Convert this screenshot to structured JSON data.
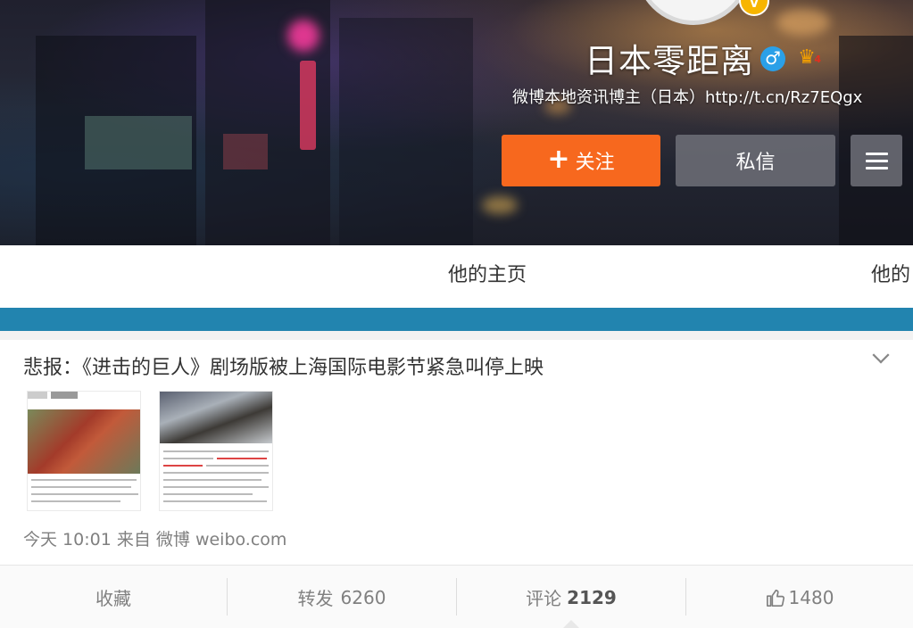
{
  "profile": {
    "name": "日本零距离",
    "description": "微博本地资讯博主（日本）http://t.cn/Rz7EQgx",
    "gender_symbol": "♂",
    "verified_badge": "V",
    "vip_symbol": "♛",
    "vip_level": "4"
  },
  "buttons": {
    "follow_icon": "+",
    "follow_label": "关注",
    "message_label": "私信",
    "menu_icon": "menu-icon"
  },
  "tabs": [
    {
      "label": "他的主页"
    },
    {
      "label": "他的"
    }
  ],
  "post": {
    "title": "悲报：《进击的巨人》剧场版被上海国际电影节紧急叫停上映",
    "time": "今天 10:01",
    "from_label": "来自",
    "source": "微博 weibo.com"
  },
  "actions": {
    "favorite_label": "收藏",
    "repost_label": "转发",
    "repost_count": "6260",
    "comment_label": "评论",
    "comment_count": "2129",
    "like_count": "1480"
  },
  "colors": {
    "follow_button": "#f7681e",
    "tab_bar_accent": "#2284af",
    "gender_badge": "#2aa0e8",
    "verified_badge": "#f7b500"
  }
}
